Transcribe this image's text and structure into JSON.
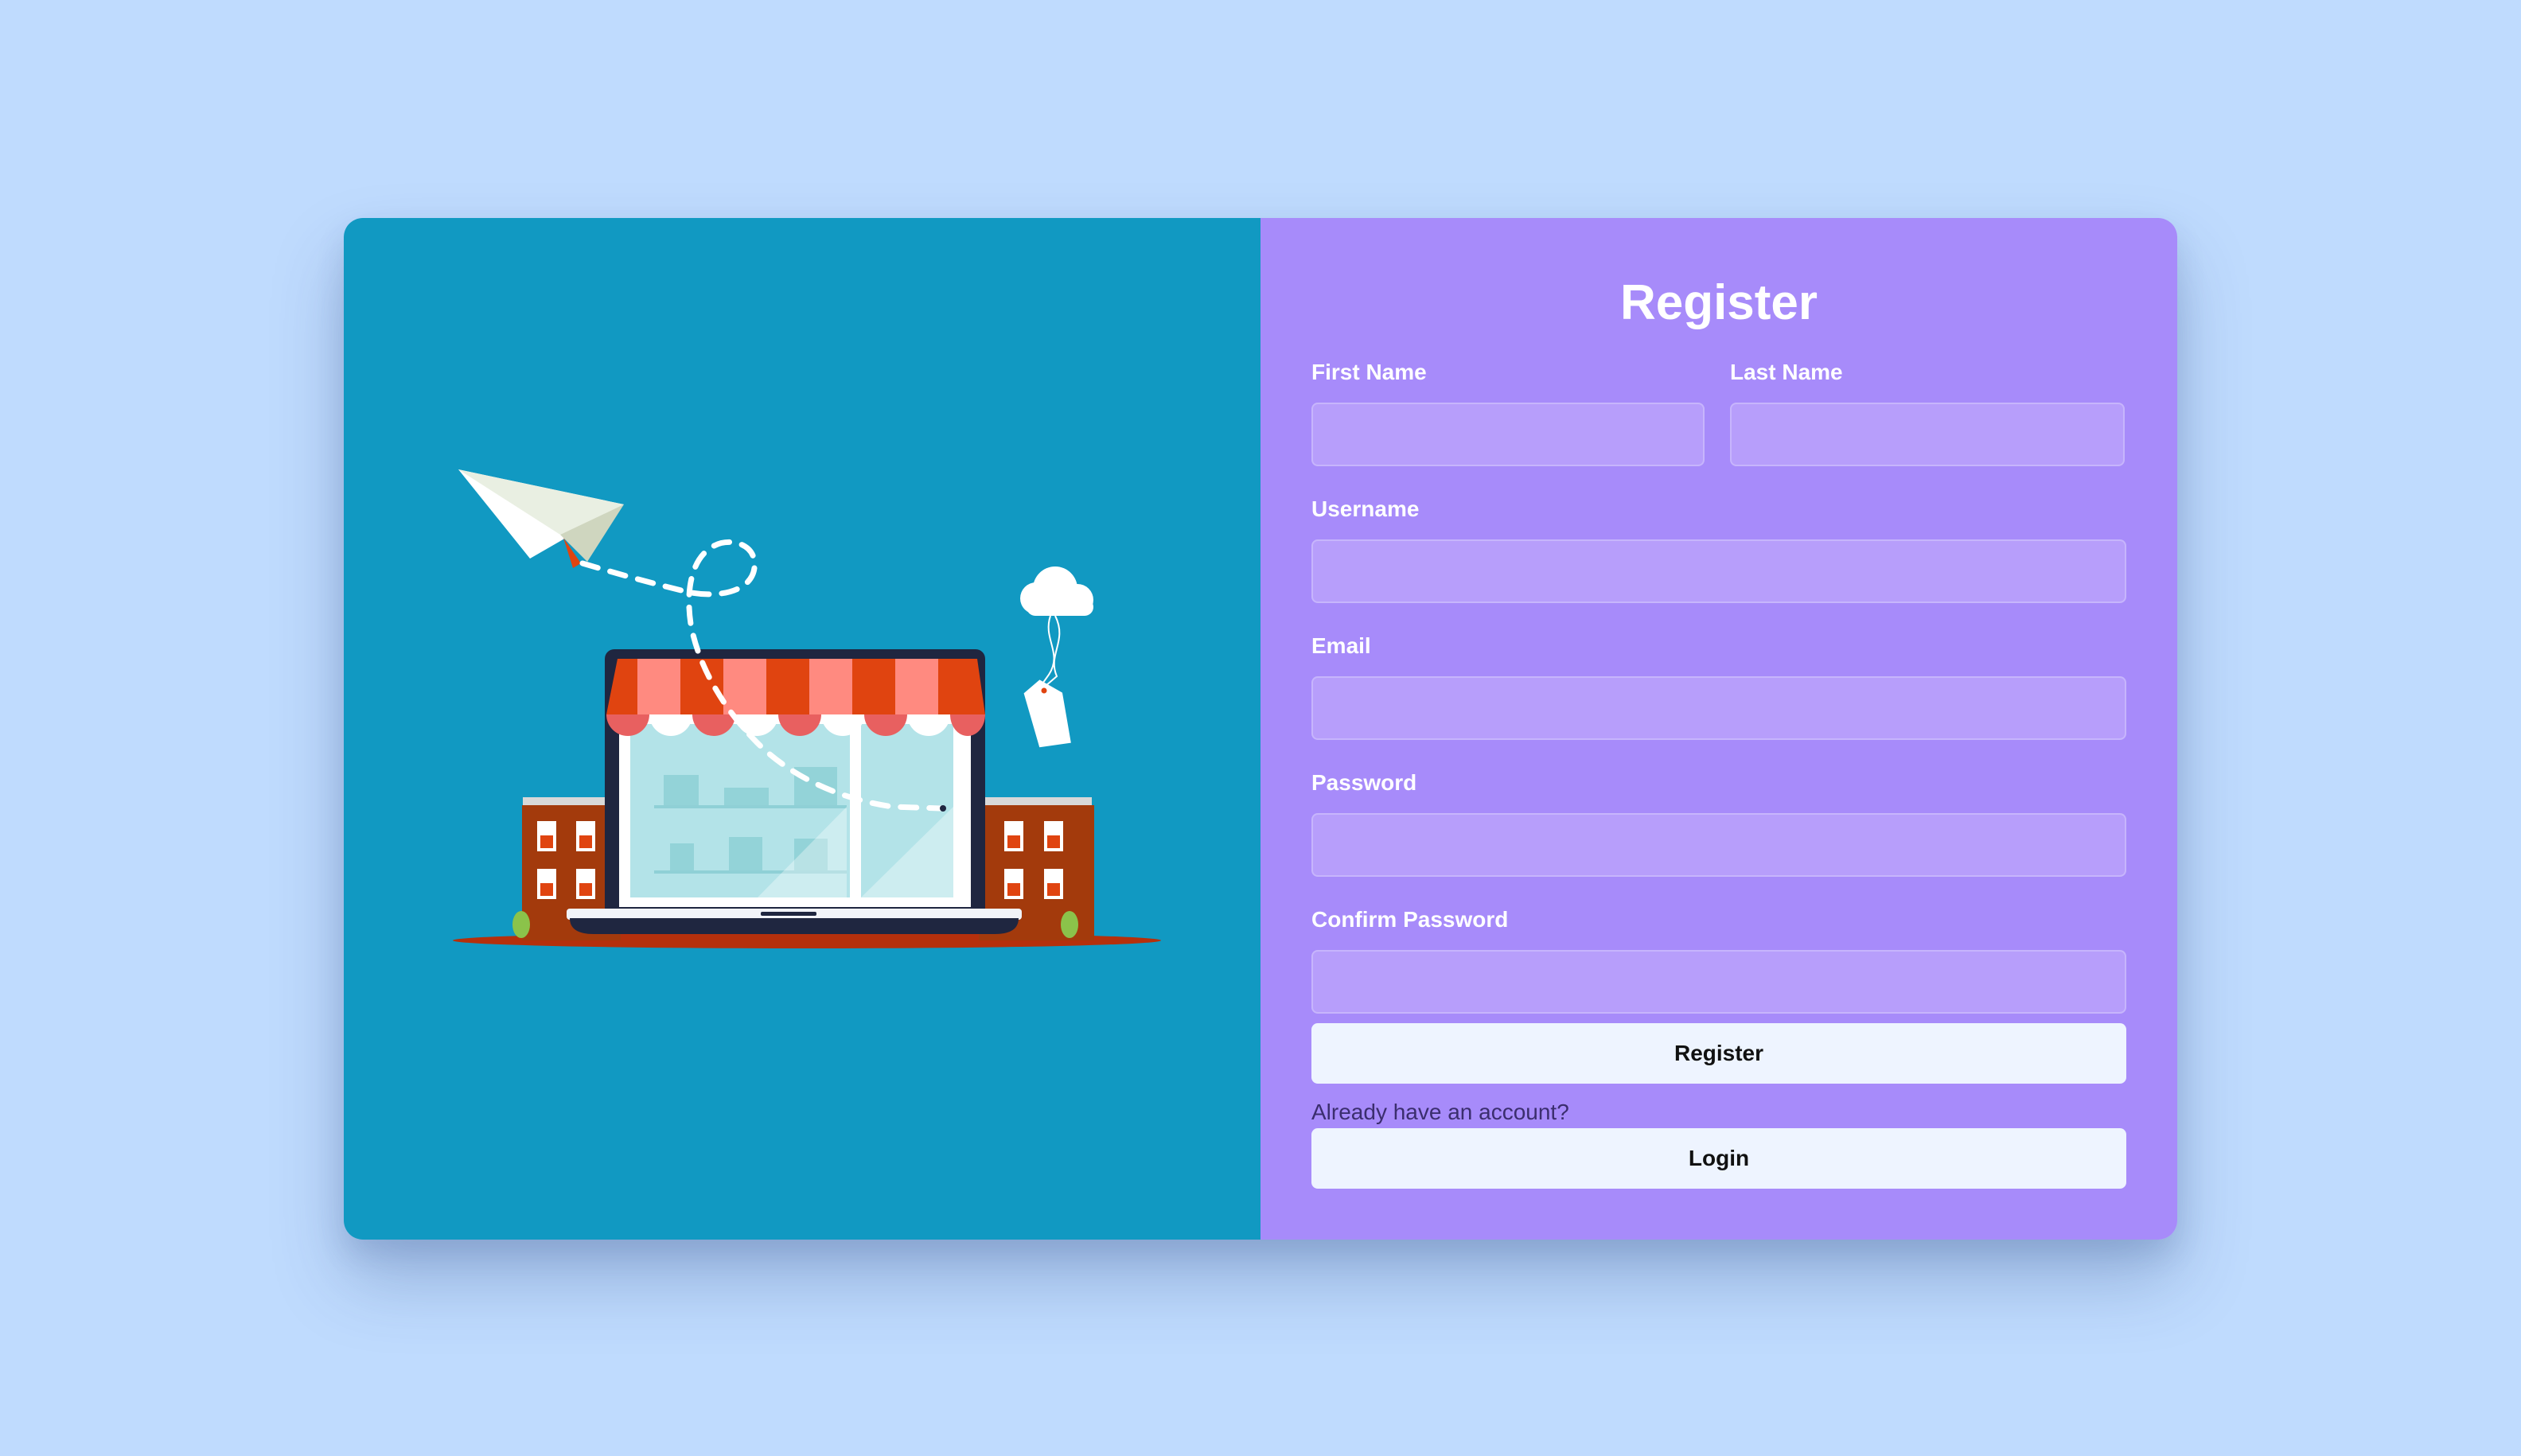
{
  "form": {
    "title": "Register",
    "fields": {
      "first_name": {
        "label": "First Name",
        "value": "",
        "placeholder": ""
      },
      "last_name": {
        "label": "Last Name",
        "value": "",
        "placeholder": ""
      },
      "username": {
        "label": "Username",
        "value": "",
        "placeholder": ""
      },
      "email": {
        "label": "Email",
        "value": "",
        "placeholder": ""
      },
      "password": {
        "label": "Password",
        "value": "",
        "placeholder": ""
      },
      "confirm_password": {
        "label": "Confirm Password",
        "value": "",
        "placeholder": ""
      }
    },
    "register_button": "Register",
    "account_prompt": "Already have an account?",
    "login_button": "Login"
  },
  "illustration": {
    "name": "online-store-laptop-illustration",
    "icons": [
      "paper-plane-icon",
      "cloud-icon",
      "price-tag-icon",
      "laptop-storefront-icon"
    ]
  },
  "colors": {
    "page_background": "#bfdbfe",
    "illustration_panel": "#1199c2",
    "form_panel": "#a78bfa",
    "input_background": "#b79efb",
    "button_background": "#eef4ff",
    "awning_red": "#e04410",
    "awning_pink": "#ff8a80"
  }
}
